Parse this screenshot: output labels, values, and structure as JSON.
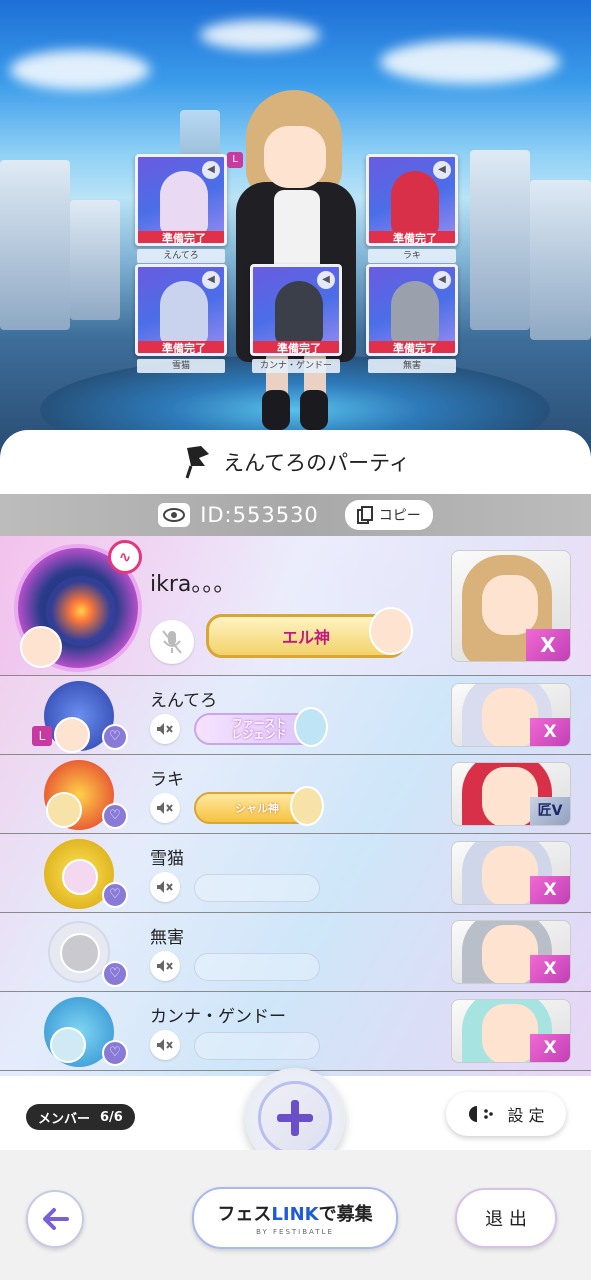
{
  "party": {
    "title": "えんてろのパーティ",
    "id_text": "ID:553530",
    "copy_label": "コピー"
  },
  "lobby": {
    "ready_label": "準備完了",
    "leader_mark": "L",
    "slots": [
      {
        "name": "えんてろ"
      },
      {
        "name": "ラキ"
      },
      {
        "name": "雪猫"
      },
      {
        "name": "カンナ・ゲンドー"
      },
      {
        "name": "無害"
      }
    ]
  },
  "members": [
    {
      "name": "ikra。。。",
      "title": "エル神",
      "rank_mark": "X"
    },
    {
      "name": "えんてろ",
      "title": "ファースト\nレジェンド",
      "rank_mark": "X",
      "leader": "L"
    },
    {
      "name": "ラキ",
      "title": "シャル神",
      "rank_mark": "匠V"
    },
    {
      "name": "雪猫",
      "title": "",
      "rank_mark": "X"
    },
    {
      "name": "無害",
      "title": "",
      "rank_mark": "X"
    },
    {
      "name": "カンナ・ゲンドー",
      "title": "",
      "rank_mark": "X"
    }
  ],
  "footer": {
    "member_label": "メンバー",
    "member_count": "6/6",
    "settings_label": "設 定",
    "recruit_prefix": "フェス",
    "recruit_link": "LINK",
    "recruit_suffix": "で募集",
    "recruit_sub": "BY FESTIBATLE",
    "exit_label": "退 出"
  },
  "colors": {
    "ready_red": "#e0304a",
    "accent_pink": "#c93aa0",
    "link_blue": "#1f5bd6"
  }
}
